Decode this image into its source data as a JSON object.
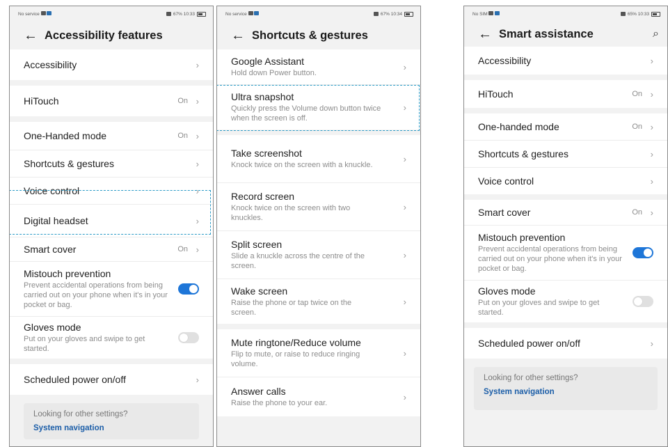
{
  "phone1": {
    "status": {
      "left": "No service",
      "right": "67%  10:33"
    },
    "title": "Accessibility features",
    "groups": [
      [
        {
          "label": "Accessibility"
        }
      ],
      [
        {
          "label": "HiTouch",
          "value": "On"
        }
      ],
      [
        {
          "label": "One-Handed mode",
          "value": "On"
        },
        {
          "label": "Shortcuts & gestures"
        },
        {
          "label": "Voice control"
        },
        {
          "label": "Digital headset"
        },
        {
          "label": "Smart cover",
          "value": "On"
        },
        {
          "label": "Mistouch prevention",
          "sub": "Prevent accidental operations from being carried out on your phone when it's in your pocket or bag."
        },
        {
          "label": "Gloves mode",
          "sub": "Put on your gloves and swipe to get started."
        }
      ],
      [
        {
          "label": "Scheduled power on/off"
        }
      ]
    ],
    "card": {
      "question": "Looking for other settings?",
      "link": "System navigation"
    }
  },
  "phone2": {
    "status": {
      "left": "No service",
      "right": "67%  10:34"
    },
    "title": "Shortcuts & gestures",
    "groups": [
      [
        {
          "label": "Google Assistant",
          "sub": "Hold down Power button."
        },
        {
          "label": "Ultra snapshot",
          "sub": "Quickly press the Volume down button twice when the screen is off."
        }
      ],
      [
        {
          "label": "Take screenshot",
          "sub": "Knock twice on the screen with a knuckle."
        },
        {
          "label": "Record screen",
          "sub": "Knock twice on the screen with two knuckles."
        },
        {
          "label": "Split screen",
          "sub": "Slide a knuckle across the centre of the screen."
        },
        {
          "label": "Wake screen",
          "sub": "Raise the phone or tap twice on the screen."
        }
      ],
      [
        {
          "label": "Mute ringtone/Reduce volume",
          "sub": "Flip to mute, or raise to reduce ringing volume."
        },
        {
          "label": "Answer calls",
          "sub": "Raise the phone to your ear."
        }
      ]
    ]
  },
  "phone3": {
    "status": {
      "left": "No SIM",
      "right": "65%  10:33"
    },
    "title": "Smart assistance",
    "groups": [
      [
        {
          "label": "Accessibility"
        }
      ],
      [
        {
          "label": "HiTouch",
          "value": "On"
        }
      ],
      [
        {
          "label": "One-handed mode",
          "value": "On"
        },
        {
          "label": "Shortcuts & gestures"
        },
        {
          "label": "Voice control"
        }
      ],
      [
        {
          "label": "Smart cover",
          "value": "On"
        },
        {
          "label": "Mistouch prevention",
          "sub": "Prevent accidental operations from being carried out on your phone when it's in your pocket or bag."
        },
        {
          "label": "Gloves mode",
          "sub": "Put on your gloves and swipe to get started."
        }
      ],
      [
        {
          "label": "Scheduled power on/off"
        }
      ]
    ],
    "card": {
      "question": "Looking for other settings?",
      "link": "System navigation"
    }
  },
  "toggles": {
    "mistouch": "on",
    "gloves": "off"
  },
  "colors": {
    "accent": "#1e76d8",
    "highlight": "#2a9ac6",
    "link": "#1c5ea8"
  }
}
